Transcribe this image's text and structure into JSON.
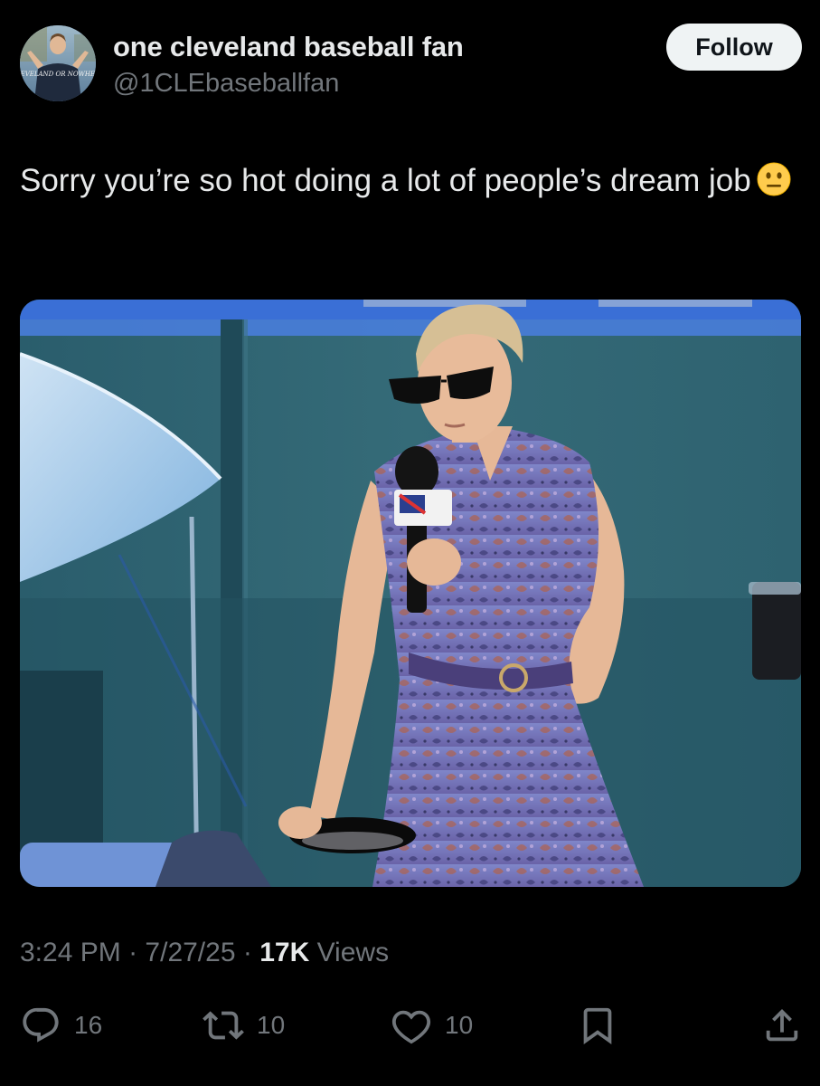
{
  "author": {
    "display_name": "one cleveland baseball fan",
    "handle": "@1CLEbaseballfan",
    "avatar_shirt_text": "CLEVELAND OR NOWHERE"
  },
  "follow_button": {
    "label": "Follow"
  },
  "tweet": {
    "text": "Sorry you’re so hot doing a lot of people’s dream job",
    "emoji": "neutral-face-emoji"
  },
  "media": {
    "icon": "photo-of-reporter-with-microphone-and-frying-pan"
  },
  "meta": {
    "time": "3:24 PM",
    "separator": "·",
    "date": "7/27/25",
    "views_count": "17K",
    "views_label": "Views"
  },
  "actions": {
    "replies": "16",
    "reposts": "10",
    "likes": "10"
  },
  "colors": {
    "background": "#000000",
    "text_primary": "#e7e9ea",
    "text_secondary": "#71767b",
    "follow_bg": "#eff3f4"
  }
}
